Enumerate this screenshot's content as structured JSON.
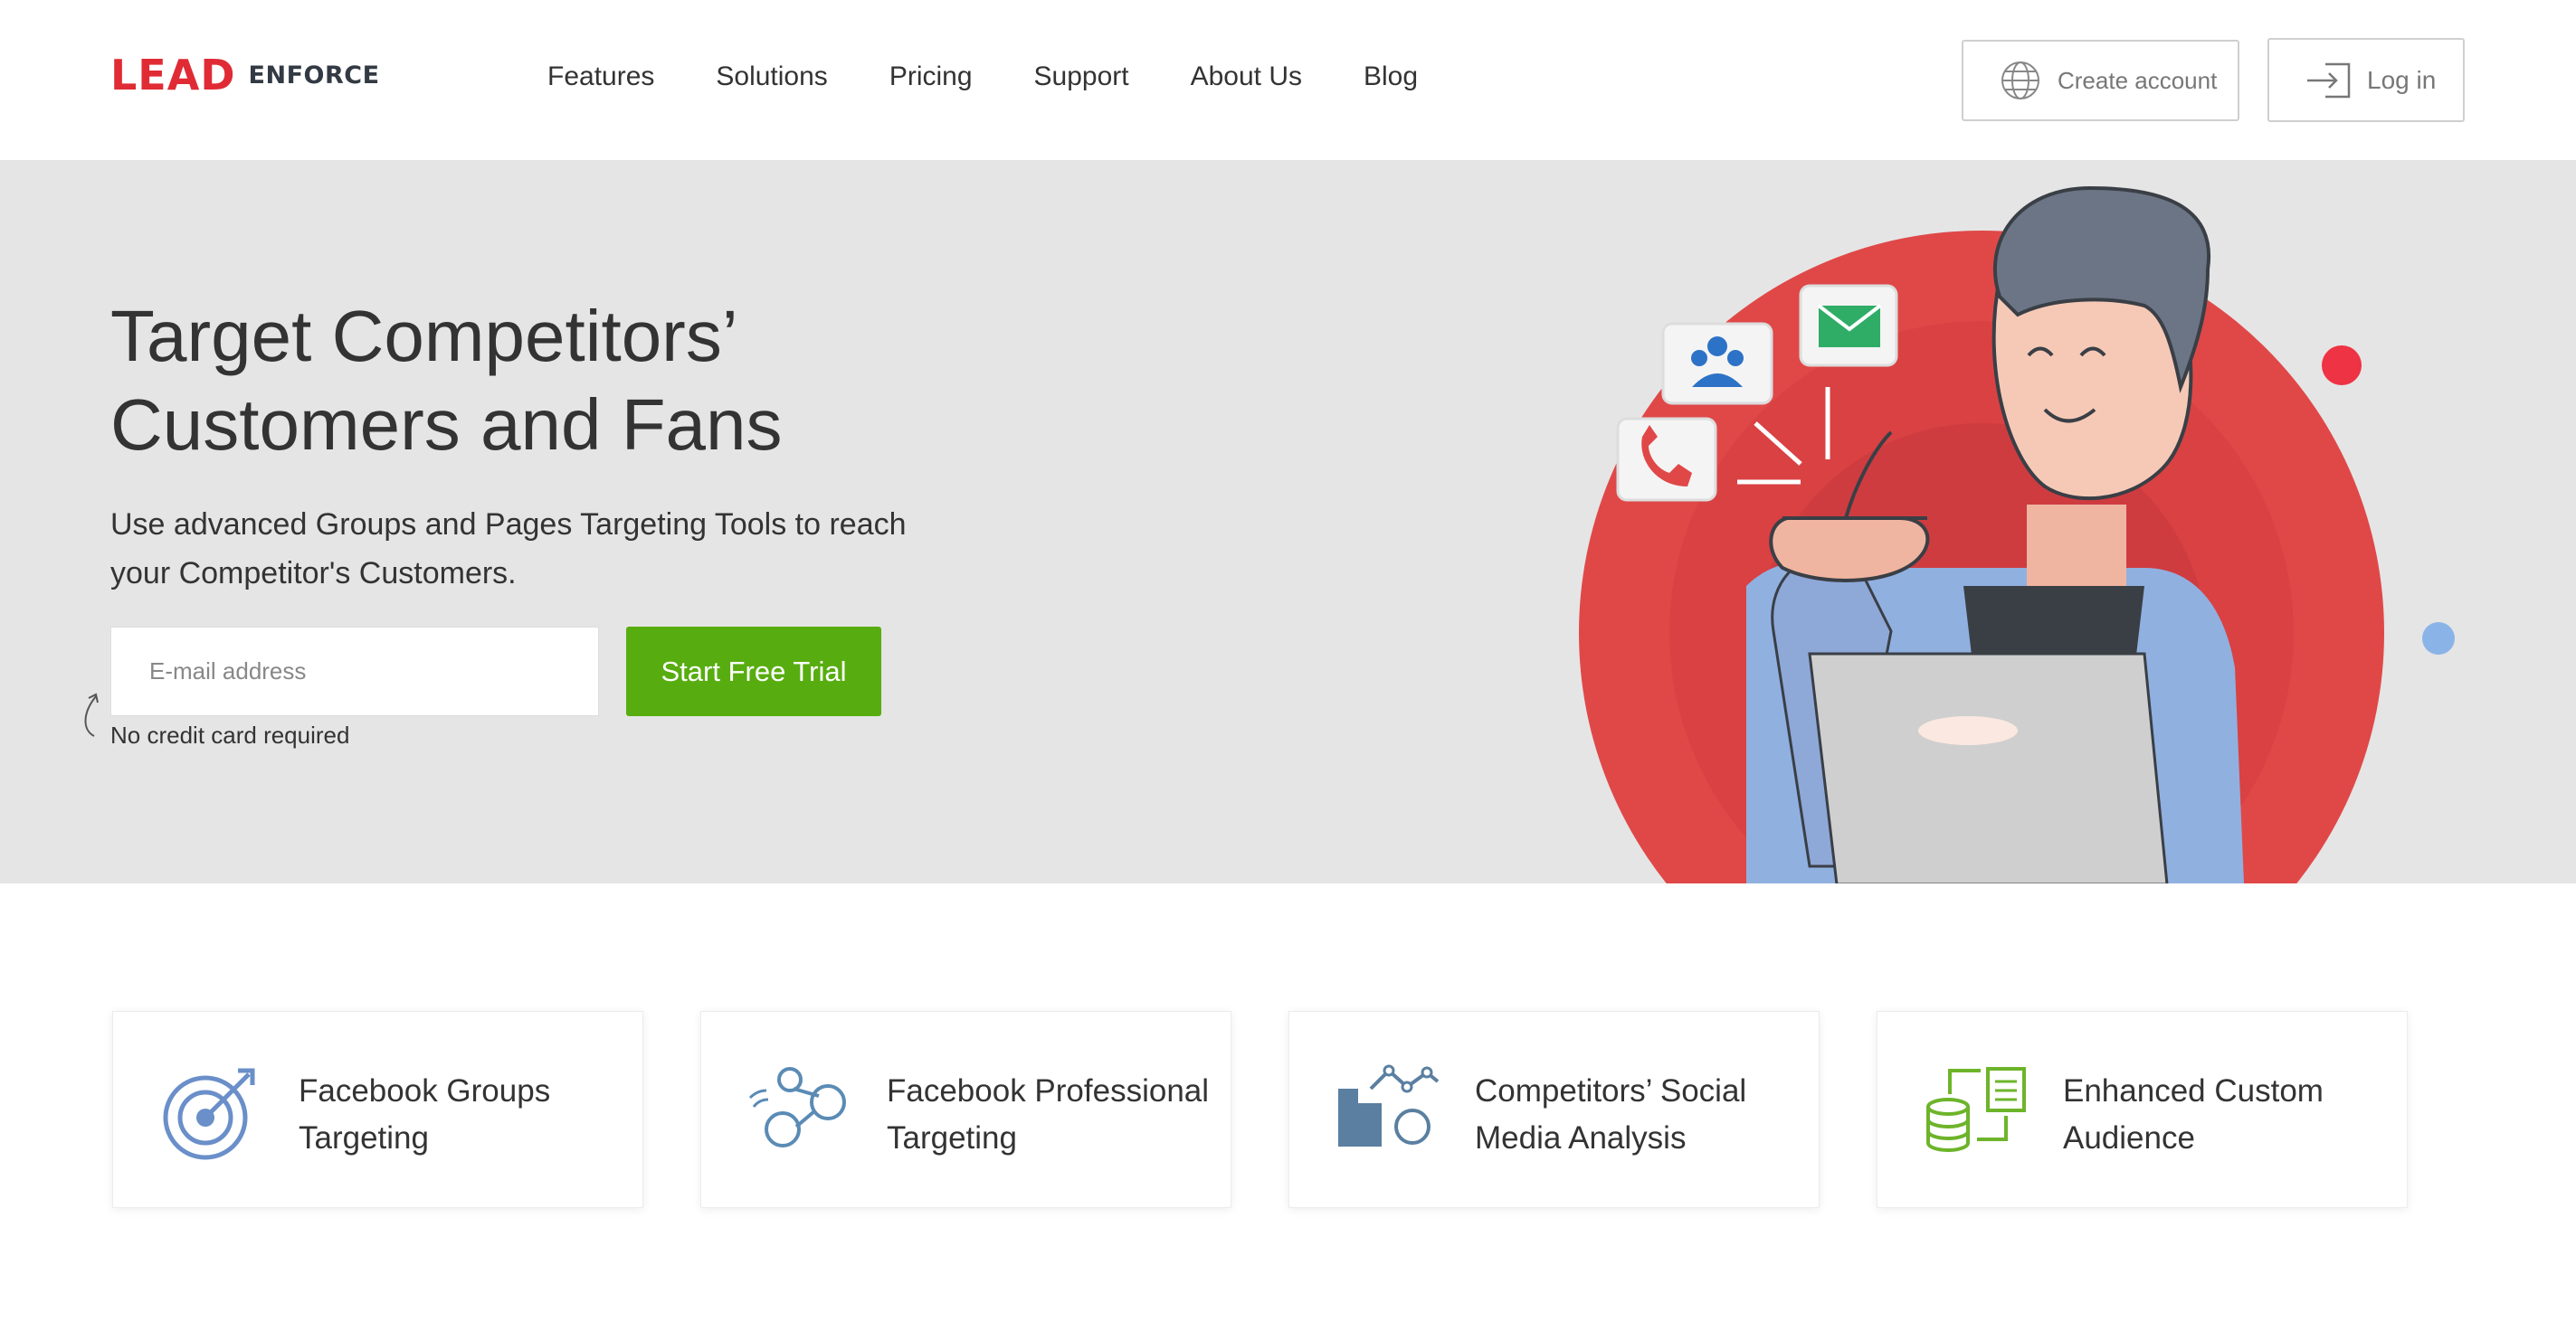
{
  "logo": {
    "lead": "LEAD",
    "enforce": "ENFORCE"
  },
  "nav": {
    "items": [
      "Features",
      "Solutions",
      "Pricing",
      "Support",
      "About Us",
      "Blog"
    ]
  },
  "header_actions": {
    "create_account": "Create account",
    "log_in": "Log in"
  },
  "hero": {
    "title_line1": "Target Competitors’",
    "title_line2": "Customers and Fans",
    "subtitle_line1": "Use advanced Groups and Pages Targeting Tools to reach",
    "subtitle_line2": "your Competitor's Customers.",
    "email_placeholder": "E-mail address",
    "cta": "Start Free Trial",
    "note": "No credit card required"
  },
  "features": [
    {
      "line1": "Facebook Groups",
      "line2": "Targeting",
      "icon": "target-icon"
    },
    {
      "line1": "Facebook Professional",
      "line2": "Targeting",
      "icon": "people-network-icon"
    },
    {
      "line1": "Competitors’ Social",
      "line2": "Media Analysis",
      "icon": "buildings-analysis-icon"
    },
    {
      "line1": "Enhanced Custom",
      "line2": "Audience",
      "icon": "database-sync-icon"
    }
  ],
  "colors": {
    "brand_red": "#e02b35",
    "cta_green": "#57ad0f",
    "hero_bg": "#e5e5e5"
  }
}
